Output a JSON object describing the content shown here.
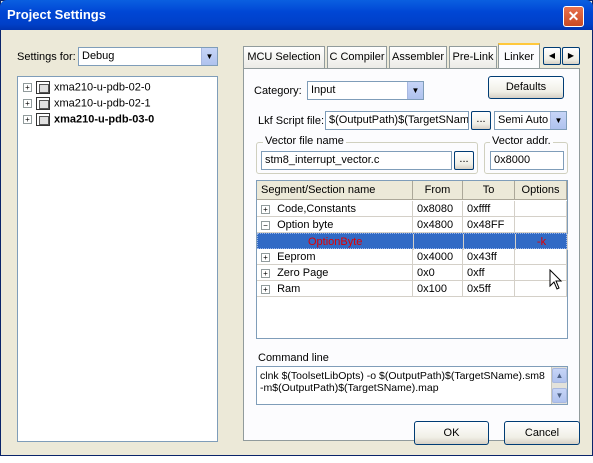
{
  "window": {
    "title": "Project Settings",
    "close_glyph": "✕"
  },
  "settings_for": {
    "label": "Settings for:",
    "value": "Debug"
  },
  "tree": {
    "items": [
      {
        "label": "xma210-u-pdb-02-0",
        "bold": false
      },
      {
        "label": "xma210-u-pdb-02-1",
        "bold": false
      },
      {
        "label": "xma210-u-pdb-03-0",
        "bold": true
      }
    ]
  },
  "tabs": [
    {
      "label": "MCU Selection",
      "selected": false
    },
    {
      "label": "C Compiler",
      "selected": false
    },
    {
      "label": "Assembler",
      "selected": false
    },
    {
      "label": "Pre-Link",
      "selected": false
    },
    {
      "label": "Linker",
      "selected": true
    }
  ],
  "tab_scroll": {
    "left": "◀",
    "right": "▶"
  },
  "linker": {
    "category_label": "Category:",
    "category_value": "Input",
    "defaults_label": "Defaults",
    "lkf_label": "Lkf Script file:",
    "lkf_value": "$(OutputPath)$(TargetSNam",
    "lkf_browse": "...",
    "lkf_mode": "Semi Auto",
    "vector_file_label": "Vector file name",
    "vector_file_value": "stm8_interrupt_vector.c",
    "vector_browse": "...",
    "vector_addr_label": "Vector addr.",
    "vector_addr_value": "0x8000",
    "columns": [
      "Segment/Section name",
      "From",
      "To",
      "Options"
    ],
    "rows": [
      {
        "expander": "+",
        "name": "Code,Constants",
        "from": "0x8080",
        "to": "0xffff",
        "options": "",
        "indent": 0,
        "selected": false
      },
      {
        "expander": "−",
        "name": "Option byte",
        "from": "0x4800",
        "to": "0x48FF",
        "options": "",
        "indent": 0,
        "selected": false
      },
      {
        "expander": "",
        "name": "OptionByte",
        "from": "",
        "to": "",
        "options": "-k",
        "indent": 1,
        "selected": true
      },
      {
        "expander": "+",
        "name": "Eeprom",
        "from": "0x4000",
        "to": "0x43ff",
        "options": "",
        "indent": 0,
        "selected": false
      },
      {
        "expander": "+",
        "name": "Zero Page",
        "from": "0x0",
        "to": "0xff",
        "options": "",
        "indent": 0,
        "selected": false
      },
      {
        "expander": "+",
        "name": "Ram",
        "from": "0x100",
        "to": "0x5ff",
        "options": "",
        "indent": 0,
        "selected": false
      }
    ],
    "command_line_label": "Command line",
    "command_line_value": "clnk $(ToolsetLibOpts) -o $(OutputPath)$(TargetSName).sm8 -m$(OutputPath)$(TargetSName).map"
  },
  "buttons": {
    "ok": "OK",
    "cancel": "Cancel"
  },
  "colors": {
    "title_bar": "#0046D5",
    "selection": "#316AC5",
    "selected_text": "#E00000",
    "dialog_bg": "#ECE9D8"
  }
}
